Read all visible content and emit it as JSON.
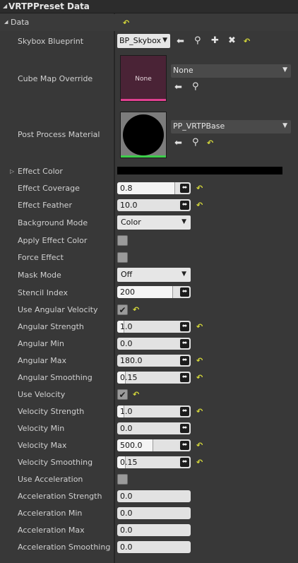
{
  "panel": {
    "title": "VRTPPreset Data"
  },
  "category": {
    "label": "Data"
  },
  "skybox": {
    "label": "Skybox Blueprint",
    "value": "BP_Skybox"
  },
  "cubemap": {
    "label": "Cube Map Override",
    "thumb_text": "None",
    "value": "None"
  },
  "postprocess": {
    "label": "Post Process Material",
    "value": "PP_VRTPBase"
  },
  "effect_color": {
    "label": "Effect Color",
    "color": "#000000"
  },
  "props": {
    "effect_coverage": {
      "label": "Effect Coverage",
      "value": "0.8"
    },
    "effect_feather": {
      "label": "Effect Feather",
      "value": "10.0"
    },
    "background_mode": {
      "label": "Background Mode",
      "value": "Color"
    },
    "apply_effect_color": {
      "label": "Apply Effect Color"
    },
    "force_effect": {
      "label": "Force Effect"
    },
    "mask_mode": {
      "label": "Mask Mode",
      "value": "Off"
    },
    "stencil_index": {
      "label": "Stencil Index",
      "value": "200"
    },
    "use_angular_velocity": {
      "label": "Use Angular Velocity"
    },
    "angular_strength": {
      "label": "Angular Strength",
      "value": "1.0"
    },
    "angular_min": {
      "label": "Angular Min",
      "value": "0.0"
    },
    "angular_max": {
      "label": "Angular Max",
      "value": "180.0"
    },
    "angular_smoothing": {
      "label": "Angular Smoothing",
      "value": "0.15"
    },
    "use_velocity": {
      "label": "Use Velocity"
    },
    "velocity_strength": {
      "label": "Velocity Strength",
      "value": "1.0"
    },
    "velocity_min": {
      "label": "Velocity Min",
      "value": "0.0"
    },
    "velocity_max": {
      "label": "Velocity Max",
      "value": "500.0"
    },
    "velocity_smoothing": {
      "label": "Velocity Smoothing",
      "value": "0.15"
    },
    "use_acceleration": {
      "label": "Use Acceleration"
    },
    "acceleration_strength": {
      "label": "Acceleration Strength",
      "value": "0.0"
    },
    "acceleration_min": {
      "label": "Acceleration Min",
      "value": "0.0"
    },
    "acceleration_max": {
      "label": "Acceleration Max",
      "value": "0.0"
    },
    "acceleration_smoothing": {
      "label": "Acceleration Smoothing",
      "value": "0.0"
    }
  },
  "glyphs": {
    "expanded": "◢",
    "collapsed": "▷",
    "dropdown": "▼",
    "reset": "↶",
    "check": "✔",
    "knob": "⬌",
    "arrow_left": "⬅",
    "search": "⚲",
    "plus": "✚",
    "clear": "✖"
  },
  "colors": {
    "reset_arrow": "#d6d93a",
    "cubemap_bar": "#e04090",
    "material_bar": "#3ccf4a"
  }
}
